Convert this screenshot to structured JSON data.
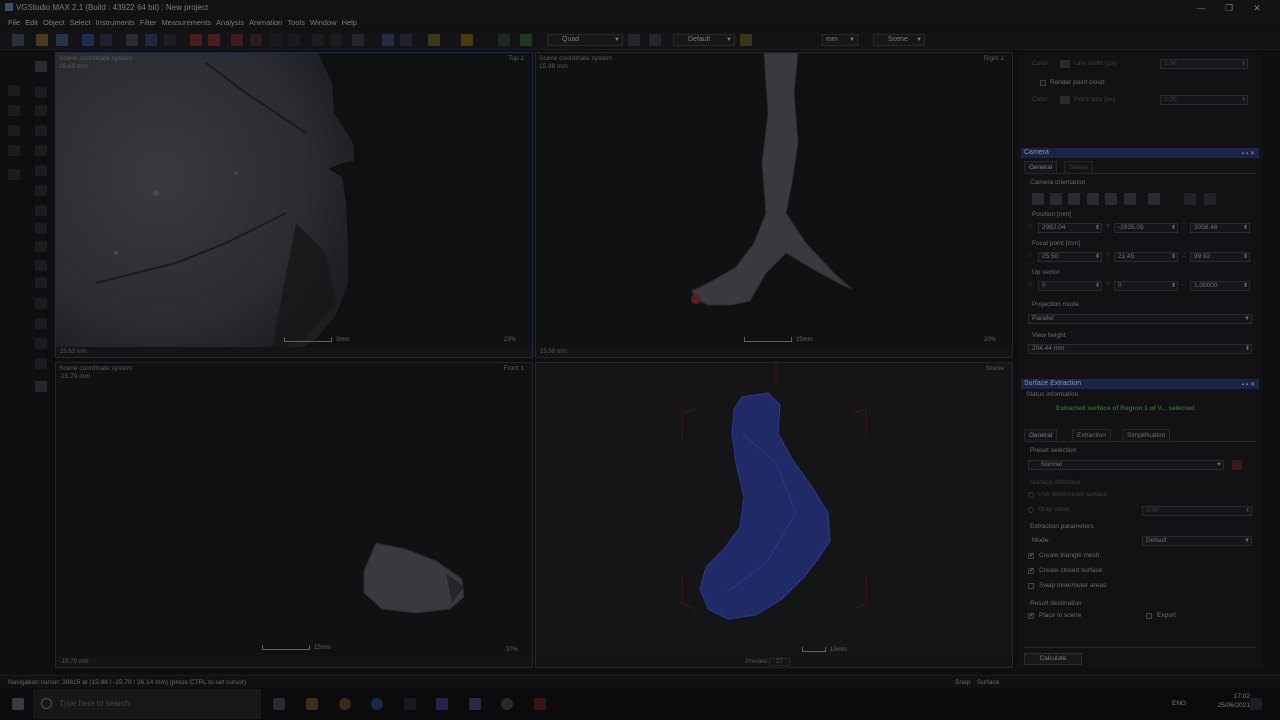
{
  "window": {
    "title": "VGStudio MAX 2.1  (Build : 43922   64 bit) : New project",
    "controls": [
      "—",
      "❐",
      "✕"
    ]
  },
  "menu": [
    "File",
    "Edit",
    "Object",
    "Select",
    "Instruments",
    "Filter",
    "Measurements",
    "Analysis",
    "Animation",
    "Tools",
    "Window",
    "Help"
  ],
  "toolbar": {
    "layout_value": "Quad",
    "style_value": "Default",
    "unit_value": "mm",
    "scene_value": "Scene"
  },
  "viewports": {
    "top": {
      "coord_label": "Scene coordinate system",
      "depth": "25.63 mm",
      "name": "Top 1",
      "status_value": "25.63 mm",
      "scale": "2mm",
      "zoom": "23%"
    },
    "right": {
      "coord_label": "Scene coordinate system",
      "depth": "15.98 mm",
      "name": "Right 1",
      "status_value": "15.98 mm",
      "scale": "25mm",
      "zoom": "20%"
    },
    "front": {
      "coord_label": "Scene coordinate system",
      "depth": "-15.79 mm",
      "name": "Front 1",
      "status_value": "-15.79 mm",
      "scale": "15mm",
      "zoom": "37%"
    },
    "scene": {
      "name": "Scene",
      "preview_label": "Preview",
      "preview_value": "27",
      "scale": "15mm"
    }
  },
  "render_panel": {
    "color_label_1": "Color",
    "line_width_label": "Line width (px)",
    "line_width_value": "1.00",
    "render_point_cloud": "Render point cloud",
    "color_label_2": "Color",
    "point_size_label": "Point size (px)",
    "point_size_value": "1.00"
  },
  "camera": {
    "title": "Camera",
    "tabs": [
      "General",
      "Stereo"
    ],
    "orientation_label": "Camera orientation",
    "position_label": "Position [mm]",
    "position": {
      "x": "2982.04",
      "y": "-2935.09",
      "z": "3056.46"
    },
    "focal_label": "Focal point [mm]",
    "focal": {
      "x": "25.50",
      "y": "21.45",
      "z": "99.92"
    },
    "up_label": "Up vector",
    "up": {
      "x": "0",
      "y": "0",
      "z": "1.00000"
    },
    "projection_label": "Projection mode",
    "projection_value": "Parallel",
    "view_height_label": "View height",
    "view_height_value": "204.44 mm"
  },
  "surface": {
    "title": "Surface Extraction",
    "status_label": "Status information",
    "status_message": "Extracted surface of Region 1 of V... selected",
    "tabs": [
      "General",
      "Extraction",
      "Simplification"
    ],
    "preset_label": "Preset selection",
    "preset_value": "Normal",
    "surface_def_label": "Surface definition",
    "use_determined": "Use determined surface",
    "gray_value_label": "Gray value",
    "gray_value": "0.00",
    "params_label": "Extraction parameters",
    "mode_label": "Mode:",
    "mode_value": "Default",
    "opt_triangle": "Create triangle mesh",
    "opt_closed": "Create closed surface",
    "opt_swap": "Swap inner/outer areas",
    "result_label": "Result destination",
    "place_in_scene": "Place in scene",
    "export": "Export",
    "calculate": "Calculate"
  },
  "statusbar": {
    "message": "Navigation cursor: 39615 at (15.98 / -15.79 / 26.14 mm) (press CTRL to set cursor)",
    "snap": "Snap",
    "snap_mode": "Surface"
  },
  "taskbar": {
    "search_placeholder": "Type here to search",
    "lang": "ENG",
    "time": "17:02",
    "date": "25/06/2021"
  },
  "colors": {
    "panel_header": "#1d2547",
    "status_green": "#2f6a2a",
    "mesh_blue": "#2a3a8e",
    "bbox_red": "#6a1a1a"
  }
}
